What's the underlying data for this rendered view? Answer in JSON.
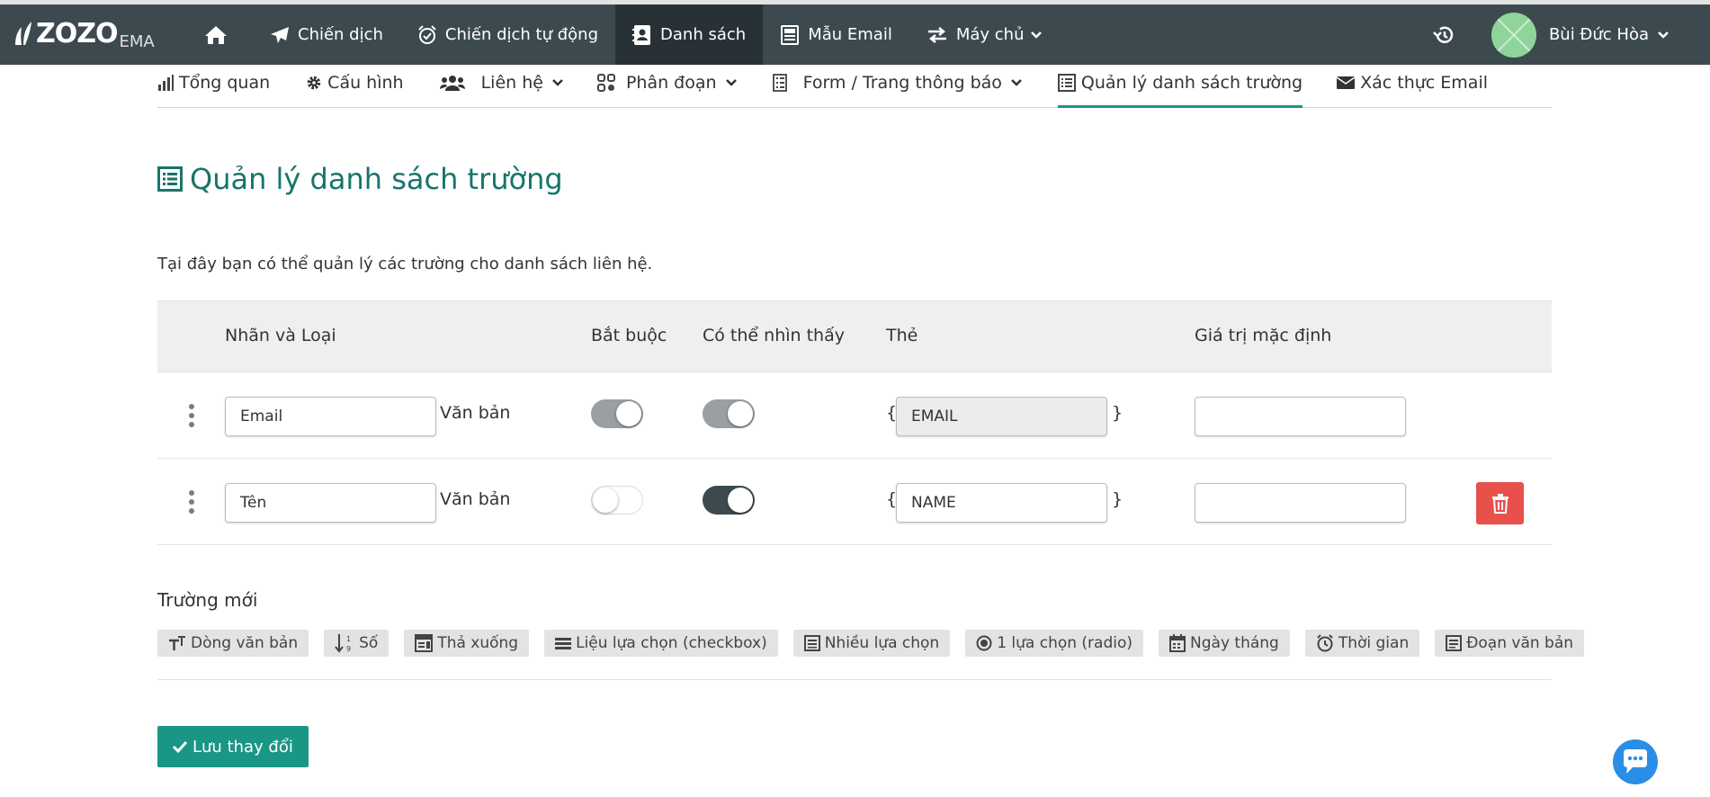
{
  "brand": {
    "logo": "ZOZO",
    "sub": "EMA"
  },
  "nav": {
    "items": [
      {
        "label": "Chiến dịch"
      },
      {
        "label": "Chiến dịch tự động"
      },
      {
        "label": "Danh sách"
      },
      {
        "label": "Mẫu Email"
      },
      {
        "label": "Máy chủ"
      }
    ]
  },
  "user": {
    "name": "Bùi Đức Hòa"
  },
  "subnav": {
    "items": [
      {
        "label": "Tổng quan"
      },
      {
        "label": "Cấu hình"
      },
      {
        "label": "Liên hệ"
      },
      {
        "label": "Phân đoạn"
      },
      {
        "label": "Form / Trang thông báo"
      },
      {
        "label": "Quản lý danh sách trường"
      },
      {
        "label": "Xác thực Email"
      }
    ]
  },
  "page": {
    "title": "Quản lý danh sách trường",
    "description": "Tại đây bạn có thể quản lý các trường cho danh sách liên hệ."
  },
  "table": {
    "headers": {
      "label_type": "Nhãn và Loại",
      "required": "Bắt buộc",
      "visible": "Có thể nhìn thấy",
      "tag": "Thẻ",
      "default": "Giá trị mặc định"
    },
    "rows": [
      {
        "label": "Email",
        "type": "Văn bản",
        "required": true,
        "visible": true,
        "tag": "EMAIL",
        "default": ""
      },
      {
        "label": "Tên",
        "type": "Văn bản",
        "required": false,
        "visible": true,
        "tag": "NAME",
        "default": ""
      }
    ],
    "brace_open": "{",
    "brace_close": "}"
  },
  "new_field": {
    "title": "Trường mới",
    "types": [
      {
        "label": "Dòng văn bản"
      },
      {
        "label": "Số"
      },
      {
        "label": "Thả xuống"
      },
      {
        "label": "Liệu lựa chọn (checkbox)"
      },
      {
        "label": "Nhiều lựa chọn"
      },
      {
        "label": "1 lựa chọn (radio)"
      },
      {
        "label": "Ngày tháng"
      },
      {
        "label": "Thời gian"
      },
      {
        "label": "Đoạn văn bản"
      }
    ]
  },
  "actions": {
    "save": "Lưu thay đổi"
  },
  "colors": {
    "topbar": "#3c4a4f",
    "accent": "#1a9685",
    "title": "#17756b",
    "danger": "#e8504b"
  }
}
